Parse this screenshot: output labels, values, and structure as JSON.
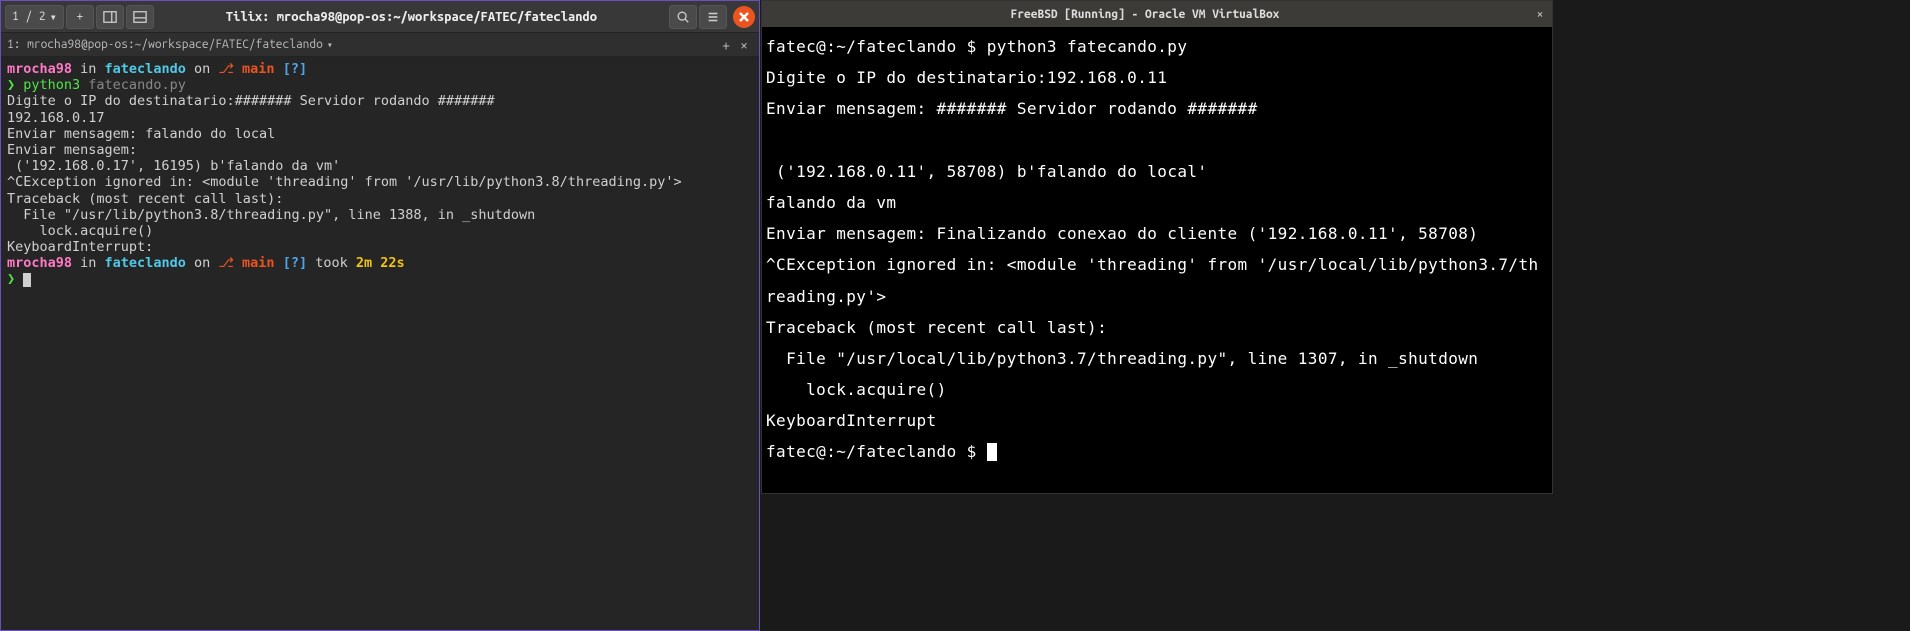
{
  "tilix": {
    "titlebar": {
      "tab_indicator": "1 / 2",
      "down_arrow": "▾",
      "plus": "+",
      "title": "Tilix: mrocha98@pop-os:~/workspace/FATEC/fateclando"
    },
    "session": {
      "label": "1: mrocha98@pop-os:~/workspace/FATEC/fateclando",
      "chevron": "▾",
      "add": "+",
      "close": "×"
    },
    "prompt1": {
      "user": "mrocha98",
      "in": " in ",
      "dir": "fateclando",
      "on": " on ",
      "branch_icon": "⎇",
      "branch": " main ",
      "flag": "[?]"
    },
    "cmd1": {
      "caret": "❯ ",
      "python3": "python3 ",
      "script": "fatecando.py"
    },
    "output": "Digite o IP do destinatario:####### Servidor rodando #######\n192.168.0.17\nEnviar mensagem: falando do local\nEnviar mensagem:\n ('192.168.0.17', 16195) b'falando da vm'\n^CException ignored in: <module 'threading' from '/usr/lib/python3.8/threading.py'>\nTraceback (most recent call last):\n  File \"/usr/lib/python3.8/threading.py\", line 1388, in _shutdown\n    lock.acquire()\nKeyboardInterrupt:",
    "prompt2": {
      "user": "mrocha98",
      "in": " in ",
      "dir": "fateclando",
      "on": " on ",
      "branch_icon": "⎇",
      "branch": " main ",
      "flag": "[?]",
      "took": " took ",
      "time": "2m 22s"
    },
    "cmd2": {
      "caret": "❯ "
    }
  },
  "vbox": {
    "title": "FreeBSD [Running] - Oracle VM VirtualBox",
    "close": "×",
    "term": {
      "l1": "fatec@:~/fateclando $ python3 fatecando.py",
      "l2": "Digite o IP do destinatario:192.168.0.11",
      "l3": "Enviar mensagem: ####### Servidor rodando #######",
      "l4": " ('192.168.0.11', 58708) b'falando do local'",
      "l5": "falando da vm",
      "l6": "Enviar mensagem: Finalizando conexao do cliente ('192.168.0.11', 58708)",
      "l7": "^CException ignored in: <module 'threading' from '/usr/local/lib/python3.7/threading.py'>",
      "l8": "Traceback (most recent call last):",
      "l9": "  File \"/usr/local/lib/python3.7/threading.py\", line 1307, in _shutdown",
      "l10": "    lock.acquire()",
      "l11": "KeyboardInterrupt",
      "l12": "fatec@:~/fateclando $ "
    }
  }
}
